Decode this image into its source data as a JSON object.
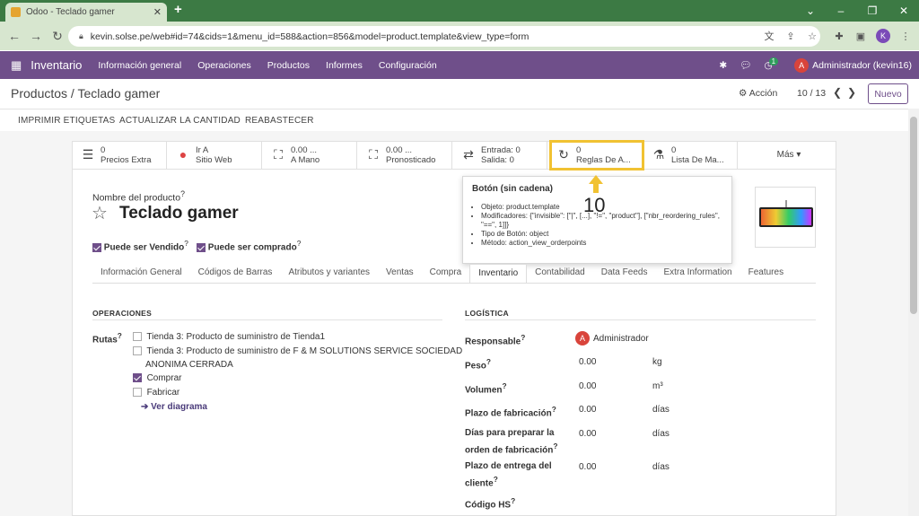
{
  "browser": {
    "tab_title": "Odoo - Teclado gamer",
    "url": "kevin.solse.pe/web#id=74&cids=1&menu_id=588&action=856&model=product.template&view_type=form",
    "profile_initial": "K"
  },
  "navbar": {
    "app_name": "Inventario",
    "menus": [
      "Información general",
      "Operaciones",
      "Productos",
      "Informes",
      "Configuración"
    ],
    "activity_badge": "1",
    "user_initial": "A",
    "user_name": "Administrador (kevin16)"
  },
  "control": {
    "breadcrumb": "Productos / Teclado gamer",
    "action_label": "Acción",
    "pager": "10 / 13",
    "new_label": "Nuevo"
  },
  "actions": [
    "IMPRIMIR ETIQUETAS",
    "ACTUALIZAR LA CANTIDAD",
    "REABASTECER"
  ],
  "smart_buttons": [
    {
      "line1": "0",
      "line2": "Precios Extra",
      "icon": "list-icon"
    },
    {
      "line1": "Ir A",
      "line2": "Sitio Web",
      "icon": "globe-icon"
    },
    {
      "line1": "0.00 ...",
      "line2": "A Mano",
      "icon": "cubes-icon"
    },
    {
      "line1": "0.00 ...",
      "line2": "Pronosticado",
      "icon": "cubes-icon"
    },
    {
      "line1": "Entrada:  0",
      "line2": "Salida:    0",
      "icon": "exchange-icon"
    },
    {
      "line1": "0",
      "line2": "Reglas De A...",
      "icon": "refresh-icon"
    },
    {
      "line1": "0",
      "line2": "Lista De Ma...",
      "icon": "flask-icon"
    }
  ],
  "more_label": "Más",
  "tooltip": {
    "title": "Botón (sin cadena)",
    "items": [
      "Objeto: product.template",
      "Modificadores: {\"invisible\": [\"|\", [...], \"!=\", \"product\"], [\"nbr_reordering_rules\", \"==\", 1]]}",
      "Tipo de Botón: object",
      "Método: action_view_orderpoints"
    ]
  },
  "step_number": "10",
  "product": {
    "name_label": "Nombre del producto",
    "name": "Teclado gamer",
    "sale_ok_label": "Puede ser Vendido",
    "purchase_ok_label": "Puede ser comprado",
    "help_mark": "?"
  },
  "tabs": [
    "Información General",
    "Códigos de Barras",
    "Atributos y variantes",
    "Ventas",
    "Compra",
    "Inventario",
    "Contabilidad",
    "Data Feeds",
    "Extra Information",
    "Features"
  ],
  "operations": {
    "title": "OPERACIONES",
    "routes_label": "Rutas",
    "routes": [
      {
        "label": "Tienda 3: Producto de suministro de Tienda1",
        "checked": false
      },
      {
        "label": "Tienda 3: Producto de suministro de F & M SOLUTIONS SERVICE SOCIEDAD",
        "label2": "ANONIMA CERRADA",
        "checked": false
      },
      {
        "label": "Comprar",
        "checked": true
      },
      {
        "label": "Fabricar",
        "checked": false
      }
    ],
    "diagram_link": "Ver diagrama"
  },
  "logistics": {
    "title": "LOGÍSTICA",
    "responsible_label": "Responsable",
    "responsible_value": "Administrador",
    "fields": [
      {
        "label": "Peso",
        "value": "0.00",
        "unit": "kg"
      },
      {
        "label": "Volumen",
        "value": "0.00",
        "unit": "m³"
      },
      {
        "label": "Plazo de fabricación",
        "value": "0.00",
        "unit": "días"
      },
      {
        "label": "Días para preparar la",
        "label2": "orden de fabricación",
        "value": "0.00",
        "unit": "días"
      },
      {
        "label": "Plazo de entrega del",
        "label2": "cliente",
        "value": "0.00",
        "unit": "días"
      }
    ],
    "hs_label": "Código HS"
  }
}
